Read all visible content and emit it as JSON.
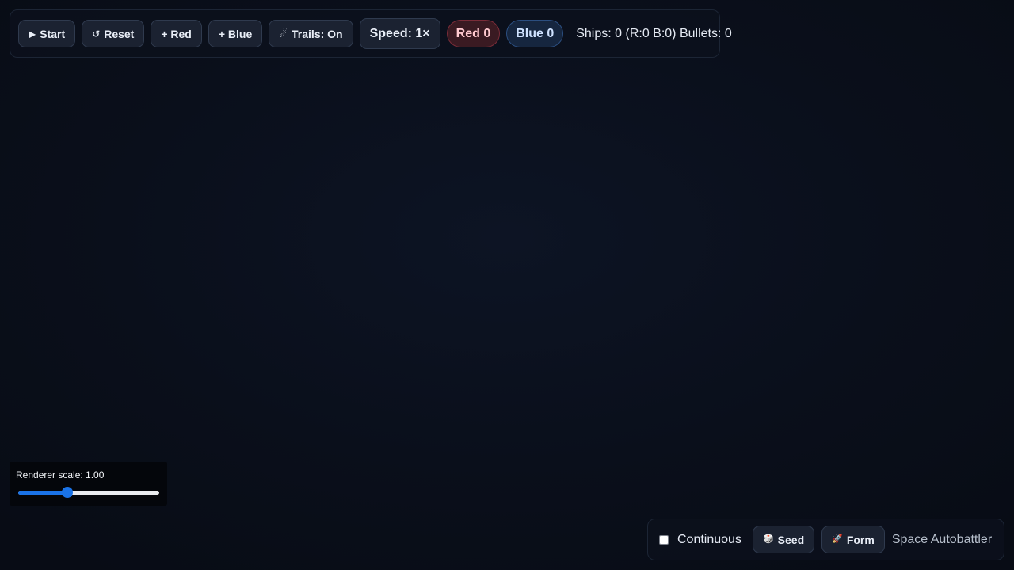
{
  "toolbar": {
    "start": {
      "icon": "▶",
      "label": "Start"
    },
    "reset": {
      "icon": "↺",
      "label": "Reset"
    },
    "add_red": "+ Red",
    "add_blue": "+ Blue",
    "trails": {
      "icon": "☄",
      "label": "Trails: On"
    },
    "speed": "Speed: 1×",
    "red_score": "Red 0",
    "blue_score": "Blue 0",
    "stats": "Ships: 0 (R:0 B:0) Bullets: 0"
  },
  "renderer": {
    "label": "Renderer scale: 1.00",
    "slider_fraction": 0.35
  },
  "bottom": {
    "continuous_label": "Continuous",
    "continuous_checked": false,
    "seed": {
      "icon": "🎲",
      "label": "Seed"
    },
    "form": {
      "icon": "🚀",
      "label": "Form"
    },
    "app_title": "Space Autobattler"
  },
  "colors": {
    "accent": "#1a73e8",
    "red_team": "#ffc9cf",
    "blue_team": "#cfe2ff"
  }
}
